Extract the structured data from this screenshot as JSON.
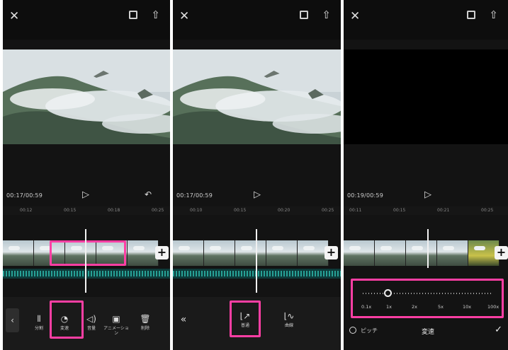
{
  "colors": {
    "highlight": "#ff3fa4",
    "audio_track": "#0e3b3a",
    "waveform": "#2bb3a6"
  },
  "icons": {
    "close": "close-icon",
    "fullscreen": "fullscreen-icon",
    "export": "export-icon",
    "play": "play-icon",
    "undo": "undo-icon",
    "add": "add-clip-icon"
  },
  "panel1": {
    "timecode": "00:17/00:59",
    "ruler": [
      "00:12",
      "00:15",
      "00:18",
      "00:25"
    ],
    "tools": [
      {
        "label": "分割",
        "icon": "split-icon"
      },
      {
        "label": "変速",
        "icon": "speed-icon"
      },
      {
        "label": "音量",
        "icon": "volume-icon"
      },
      {
        "label": "アニメーション",
        "icon": "animation-icon"
      },
      {
        "label": "削除",
        "icon": "delete-icon"
      }
    ]
  },
  "panel2": {
    "timecode": "00:17/00:59",
    "ruler": [
      "00:10",
      "00:15",
      "00:20",
      "00:25"
    ],
    "options": [
      {
        "label": "普通",
        "icon": "normal-speed-icon"
      },
      {
        "label": "曲線",
        "icon": "curve-speed-icon"
      }
    ]
  },
  "panel3": {
    "timecode": "00:19/00:59",
    "ruler": [
      "00:11",
      "00:15",
      "00:21",
      "00:25"
    ],
    "speed_marks": [
      "0.1x",
      "1x",
      "2x",
      "5x",
      "10x",
      "100x"
    ],
    "speed_value_fraction": 0.2,
    "pitch_label": "ピッチ",
    "title": "変速",
    "confirm_icon": "checkmark-icon"
  }
}
